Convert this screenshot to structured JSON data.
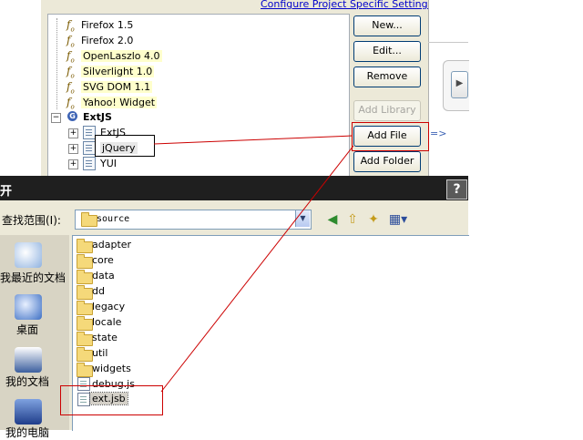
{
  "ide": {
    "configure_link": "Configure Project Specific Settings...",
    "libraries": [
      {
        "label": "Firefox 1.5"
      },
      {
        "label": "Firefox 2.0"
      },
      {
        "label": "OpenLaszlo 4.0"
      },
      {
        "label": "Silverlight 1.0"
      },
      {
        "label": "SVG DOM 1.1"
      },
      {
        "label": "Yahoo! Widget"
      }
    ],
    "user_library": {
      "label": "ExtJS",
      "children": [
        {
          "label": "ExtJS"
        },
        {
          "label": "jQuery"
        },
        {
          "label": "YUI"
        }
      ]
    },
    "buttons": {
      "new": "New...",
      "edit": "Edit...",
      "remove": "Remove",
      "add_library": "Add Library",
      "add_file": "Add File",
      "add_folder": "Add Folder"
    },
    "arrow_text": "=>"
  },
  "dialog": {
    "title": "开",
    "help": "?",
    "look_in_label": "查找范围(I):",
    "look_in_value": "source",
    "places": [
      {
        "label": "我最近的文档",
        "icon": "recent-documents-icon"
      },
      {
        "label": "桌面",
        "icon": "desktop-icon"
      },
      {
        "label": "我的文档",
        "icon": "my-documents-icon"
      },
      {
        "label": "我的电脑",
        "icon": "my-computer-icon"
      }
    ],
    "folders": [
      "adapter",
      "core",
      "data",
      "dd",
      "legacy",
      "locale",
      "state",
      "util",
      "widgets"
    ],
    "files": [
      "debug.js",
      "ext.jsb"
    ]
  },
  "colors": {
    "annotation": "#cc0000",
    "title_bar": "#1f1f1f",
    "dialog_bg": "#ece9d8"
  }
}
